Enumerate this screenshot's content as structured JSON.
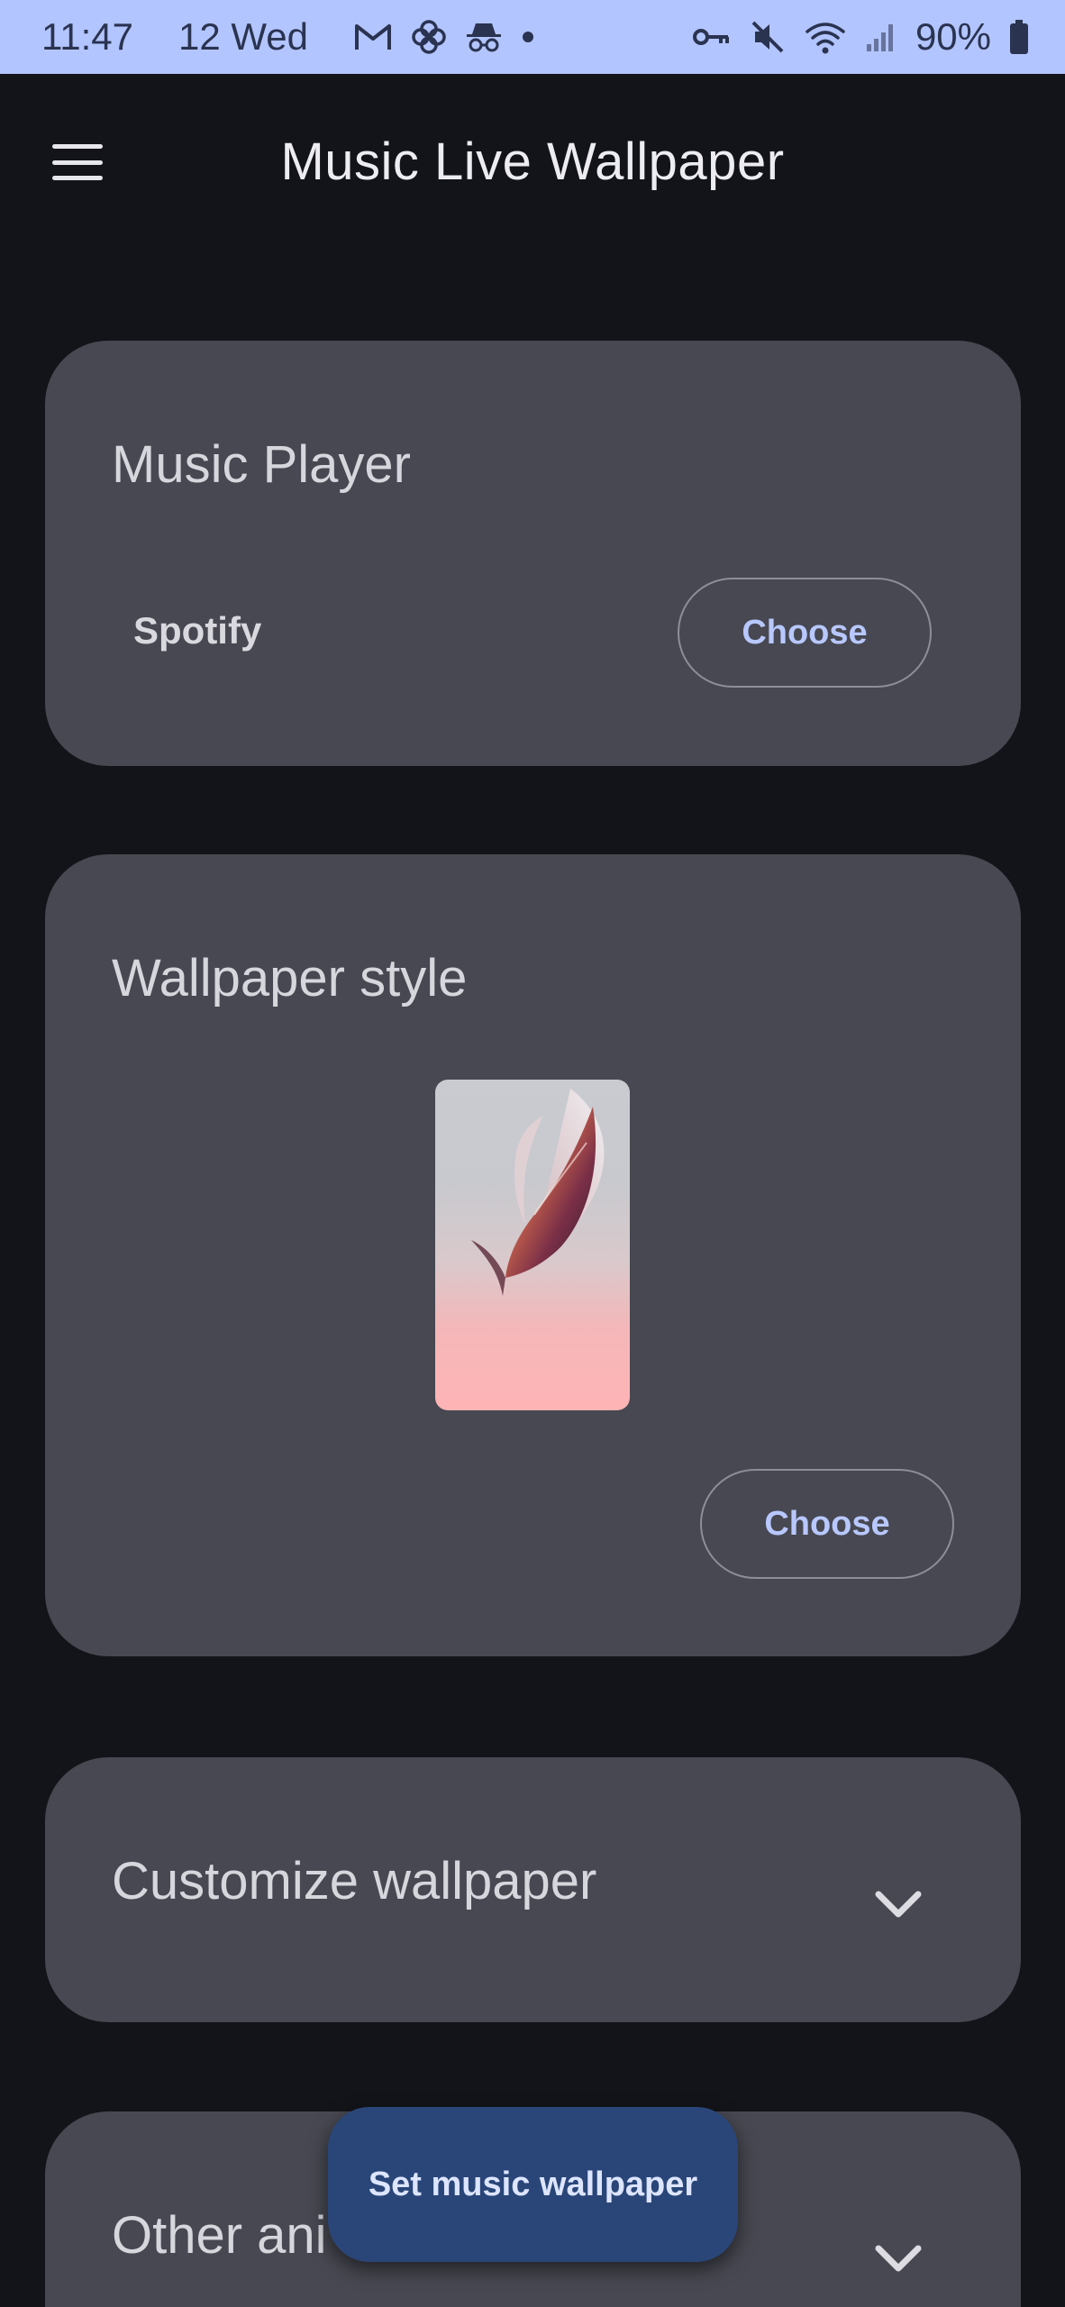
{
  "status_bar": {
    "time": "11:47",
    "date": "12 Wed",
    "battery": "90%",
    "icons": [
      "gmail-icon",
      "pinwheel-icon",
      "incognito-icon",
      "dot-icon",
      "vpn-key-icon",
      "mute-icon",
      "wifi-icon",
      "signal-icon",
      "battery-icon"
    ]
  },
  "appbar": {
    "title": "Music Live Wallpaper",
    "menu_icon": "menu-icon"
  },
  "music_player_card": {
    "title": "Music Player",
    "selected": "Spotify",
    "button": "Choose"
  },
  "style_card": {
    "title": "Wallpaper style",
    "button": "Choose",
    "preview": "wallpaper-preview"
  },
  "customize_card": {
    "title": "Customize wallpaper",
    "icon": "chevron-down-icon"
  },
  "other_card": {
    "title": "Other ani",
    "icon": "chevron-down-icon"
  },
  "fab": {
    "label": "Set music wallpaper"
  },
  "colors": {
    "status_bar": "#b3c5ff",
    "background": "#131419",
    "card": "#474851",
    "accent_text": "#b8c8ff",
    "fab": "#2a4678"
  }
}
